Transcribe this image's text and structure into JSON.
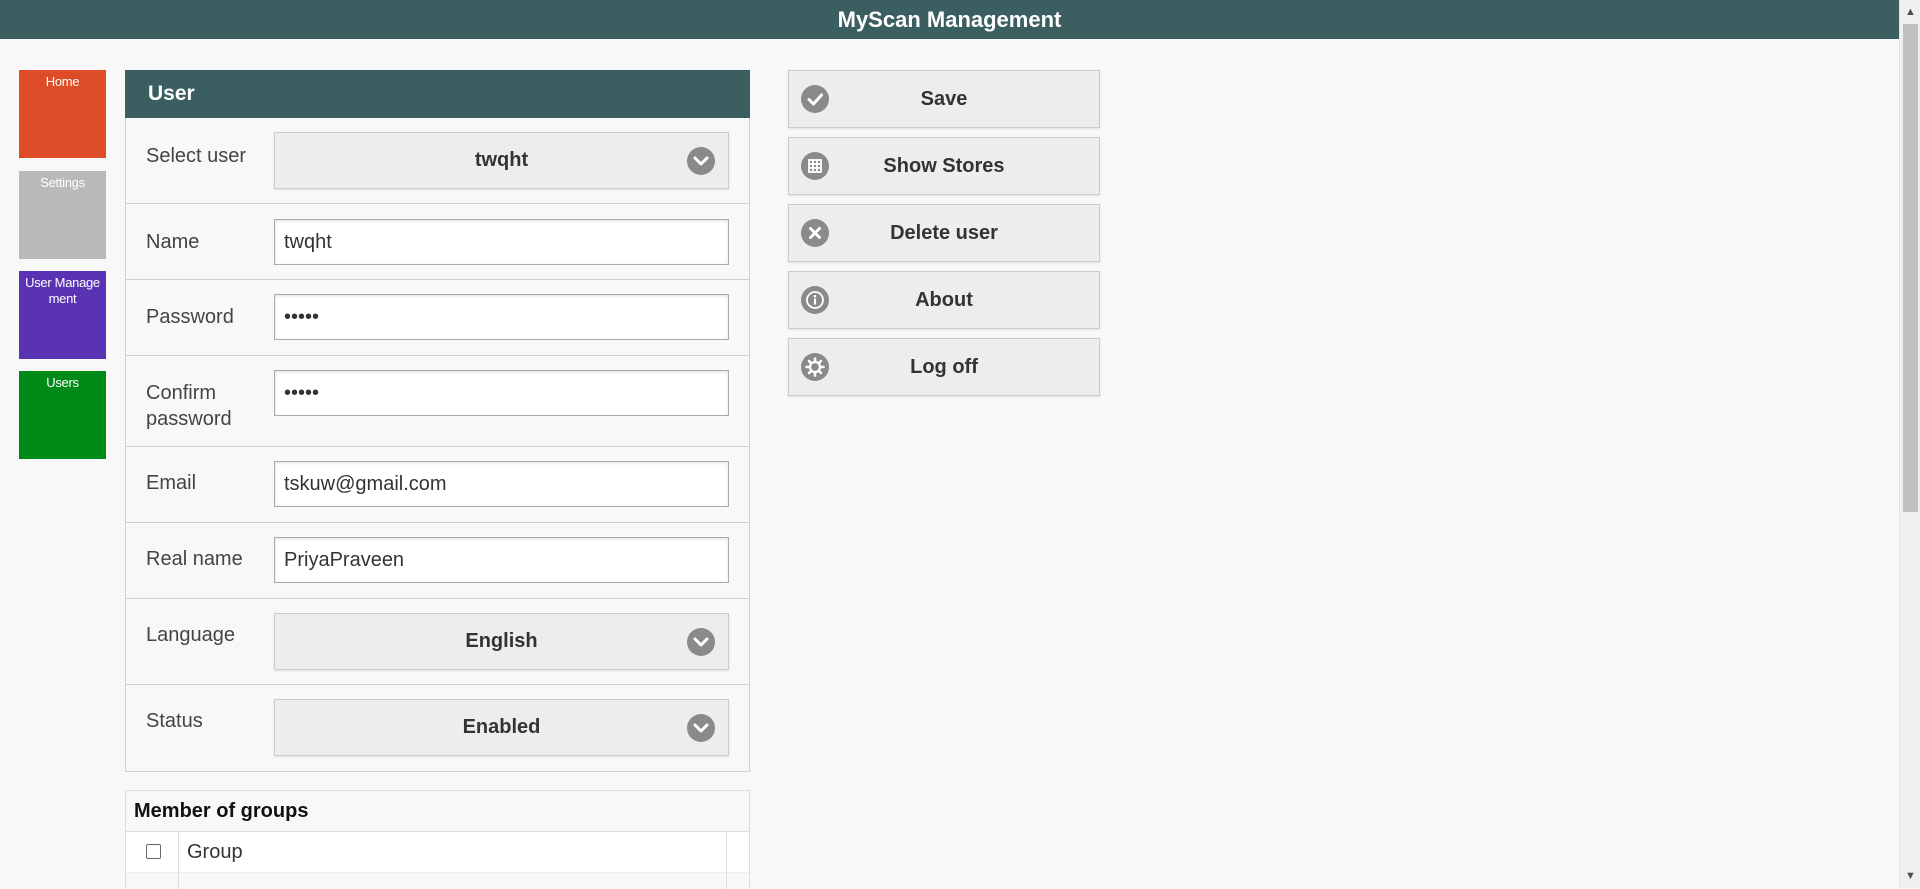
{
  "app": {
    "title": "MyScan Management"
  },
  "tiles": [
    {
      "label": "Home",
      "color": "#dd4b27"
    },
    {
      "label": "Settings",
      "color": "#b9b9b9"
    },
    {
      "label": "User Manage ment",
      "color": "#5a33b4"
    },
    {
      "label": "Users",
      "color": "#008a17"
    }
  ],
  "user_panel": {
    "title": "User",
    "select_user": {
      "label": "Select user",
      "value": "twqht"
    },
    "name": {
      "label": "Name",
      "value": "twqht"
    },
    "password": {
      "label": "Password",
      "value": "•••••"
    },
    "confirm_password": {
      "label": "Confirm password",
      "value": "•••••"
    },
    "email": {
      "label": "Email",
      "value": "tskuw@gmail.com"
    },
    "real_name": {
      "label": "Real name",
      "value": "PriyaPraveen"
    },
    "language": {
      "label": "Language",
      "value": "English"
    },
    "status": {
      "label": "Status",
      "value": "Enabled"
    }
  },
  "groups": {
    "title": "Member of groups",
    "column_header": "Group"
  },
  "actions": [
    {
      "label": "Save",
      "icon": "check-icon"
    },
    {
      "label": "Show Stores",
      "icon": "grid-icon"
    },
    {
      "label": "Delete user",
      "icon": "close-icon"
    },
    {
      "label": "About",
      "icon": "info-icon"
    },
    {
      "label": "Log off",
      "icon": "gear-icon"
    }
  ]
}
